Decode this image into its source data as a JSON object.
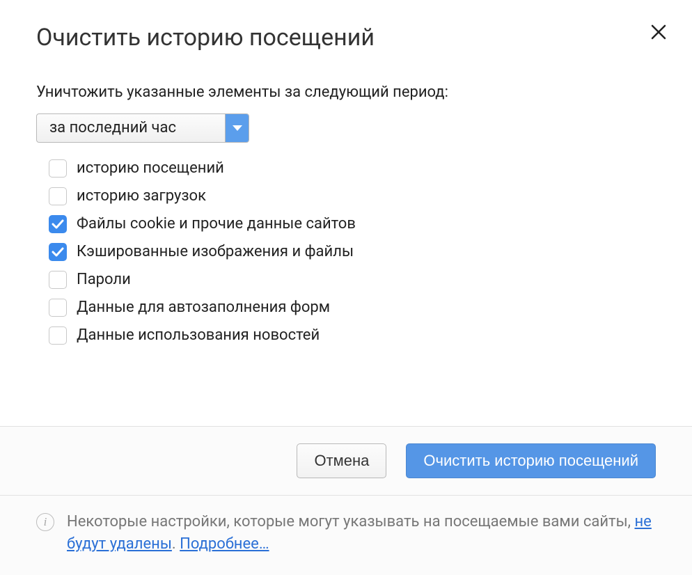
{
  "dialog": {
    "title": "Очистить историю посещений",
    "prompt": "Уничтожить указанные элементы за следующий период:",
    "period_selected": "за последний час",
    "options": [
      {
        "label": "историю посещений",
        "checked": false
      },
      {
        "label": "историю загрузок",
        "checked": false
      },
      {
        "label": "Файлы cookie и прочие данные сайтов",
        "checked": true
      },
      {
        "label": "Кэшированные изображения и файлы",
        "checked": true
      },
      {
        "label": "Пароли",
        "checked": false
      },
      {
        "label": "Данные для автозаполнения форм",
        "checked": false
      },
      {
        "label": "Данные использования новостей",
        "checked": false
      }
    ],
    "buttons": {
      "cancel": "Отмена",
      "confirm": "Очистить историю посещений"
    },
    "footer": {
      "text_before": "Некоторые настройки, которые могут указывать на посещаемые вами сайты, ",
      "link1": "не будут удалены",
      "separator": ". ",
      "link2": "Подробнее…"
    }
  }
}
